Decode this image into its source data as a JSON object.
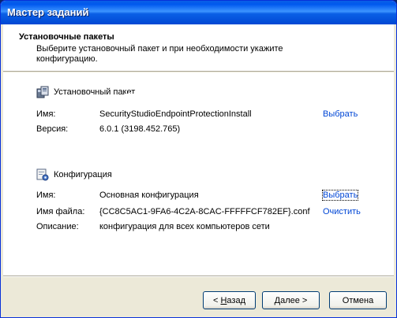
{
  "window": {
    "title": "Мастер заданий"
  },
  "header": {
    "title": "Установочные пакеты",
    "description": "Выберите установочный пакет и при необходимости укажите конфигурацию."
  },
  "package_section": {
    "heading": "Установочный пакет",
    "name_label": "Имя:",
    "name_value": "SecurityStudioEndpointProtectionInstall",
    "version_label": "Версия:",
    "version_value": "6.0.1 (3198.452.765)",
    "select_link": "Выбрать"
  },
  "config_section": {
    "heading": "Конфигурация",
    "name_label": "Имя:",
    "name_value": "Основная конфигурация",
    "file_label": "Имя файла:",
    "file_value": "{CC8C5AC1-9FA6-4C2A-8CAC-FFFFFCF782EF}.conf",
    "desc_label": "Описание:",
    "desc_value": "конфигурация для всех компьютеров сети",
    "select_link": "Выбрать",
    "clear_link": "Очистить"
  },
  "buttons": {
    "back_prefix": "< ",
    "back_mnemonic": "Н",
    "back_rest": "азад",
    "next_mnemonic": "Д",
    "next_rest": "алее >",
    "cancel": "Отмена"
  }
}
